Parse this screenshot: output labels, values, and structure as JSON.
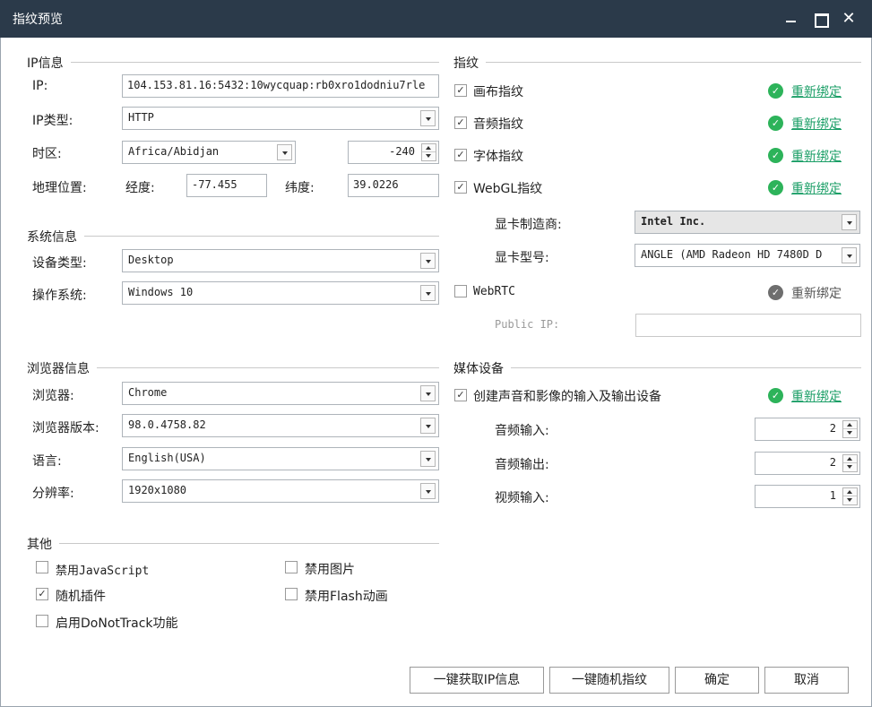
{
  "window": {
    "title": "指纹预览"
  },
  "ip_section": {
    "heading": "IP信息",
    "ip_label": "IP:",
    "ip_value": "104.153.81.16:5432:10wycquap:rb0xro1dodniu7rle",
    "type_label": "IP类型:",
    "type_value": "HTTP",
    "tz_label": "时区:",
    "tz_value": "Africa/Abidjan",
    "tz_offset": "-240",
    "geo_label": "地理位置:",
    "lng_label": "经度:",
    "lng_value": "-77.455",
    "lat_label": "纬度:",
    "lat_value": "39.0226"
  },
  "system_section": {
    "heading": "系统信息",
    "device_label": "设备类型:",
    "device_value": "Desktop",
    "os_label": "操作系统:",
    "os_value": "Windows 10"
  },
  "browser_section": {
    "heading": "浏览器信息",
    "browser_label": "浏览器:",
    "browser_value": "Chrome",
    "version_label": "浏览器版本:",
    "version_value": "98.0.4758.82",
    "lang_label": "语言:",
    "lang_value": "English(USA)",
    "res_label": "分辨率:",
    "res_value": "1920x1080"
  },
  "other_section": {
    "heading": "其他",
    "disable_js": {
      "label": "禁用JavaScript",
      "checked": false
    },
    "disable_images": {
      "label": "禁用图片",
      "checked": false
    },
    "random_plugins": {
      "label": "随机插件",
      "checked": true
    },
    "disable_flash": {
      "label": "禁用Flash动画",
      "checked": false
    },
    "dnt": {
      "label": "启用DoNotTrack功能",
      "checked": false
    }
  },
  "fingerprint_section": {
    "heading": "指纹",
    "rebind_label": "重新绑定",
    "canvas": {
      "label": "画布指纹",
      "checked": true
    },
    "audio": {
      "label": "音频指纹",
      "checked": true
    },
    "font": {
      "label": "字体指纹",
      "checked": true
    },
    "webgl": {
      "label": "WebGL指纹",
      "checked": true
    },
    "gpu_vendor_label": "显卡制造商:",
    "gpu_vendor_value": "Intel Inc.",
    "gpu_model_label": "显卡型号:",
    "gpu_model_value": "ANGLE (AMD Radeon HD 7480D D",
    "webrtc": {
      "label": "WebRTC",
      "checked": false
    },
    "public_ip_label": "Public IP:",
    "public_ip_value": ""
  },
  "media_section": {
    "heading": "媒体设备",
    "create_devices": {
      "label": "创建声音和影像的输入及输出设备",
      "checked": true
    },
    "audio_in_label": "音频输入:",
    "audio_in_value": "2",
    "audio_out_label": "音频输出:",
    "audio_out_value": "2",
    "video_in_label": "视频输入:",
    "video_in_value": "1"
  },
  "buttons": {
    "fetch_ip": "一键获取IP信息",
    "random_fp": "一键随机指纹",
    "ok": "确定",
    "cancel": "取消"
  },
  "colors": {
    "titlebar": "#2b3a4a",
    "accent_green": "#2db35a",
    "link_green": "#1a9e66"
  },
  "icons": {
    "minimize": "minimize-icon",
    "maximize": "maximize-icon",
    "close": "close-icon",
    "rebind_ok": "check-circle-icon",
    "checkbox_checked": "checkmark-icon"
  }
}
